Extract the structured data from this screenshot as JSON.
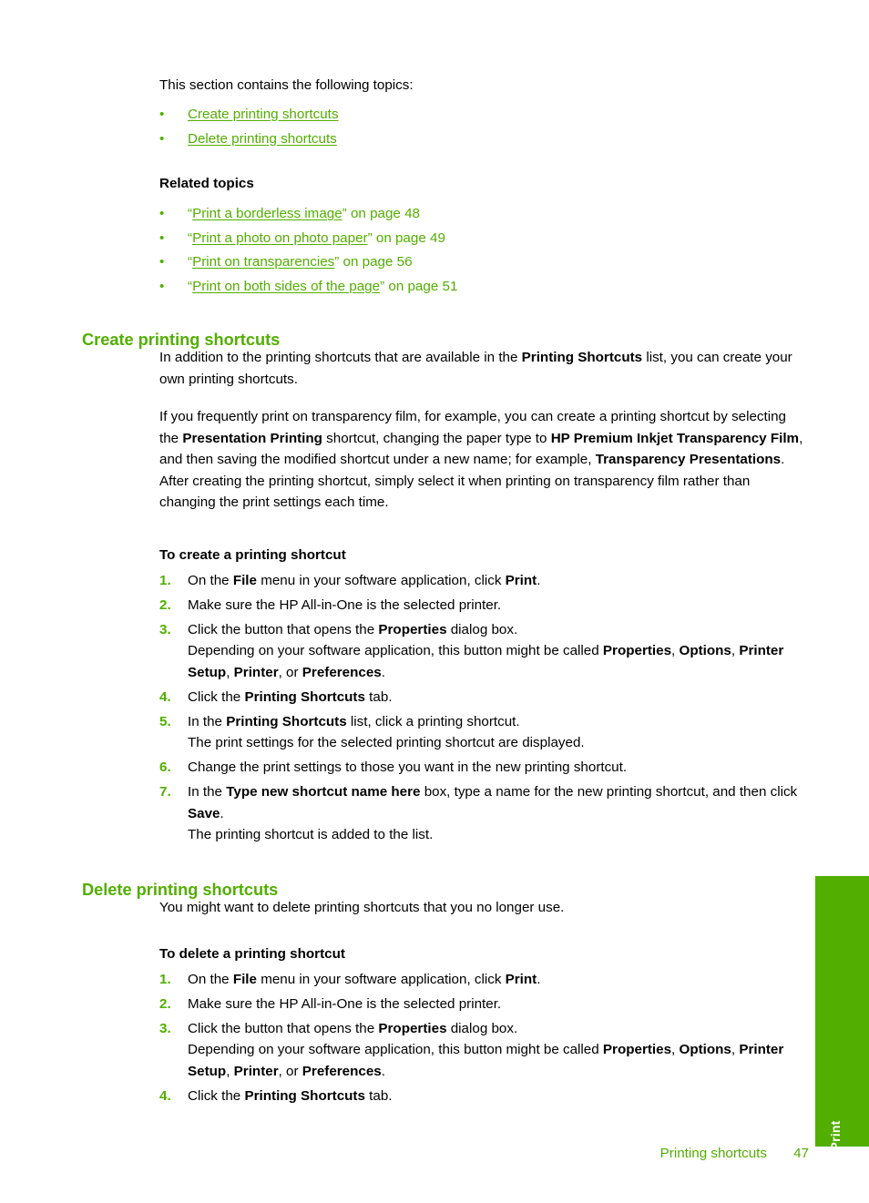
{
  "intro": {
    "lead": "This section contains the following topics:",
    "topics": [
      {
        "label": "Create printing shortcuts"
      },
      {
        "label": "Delete printing shortcuts"
      }
    ]
  },
  "related": {
    "heading": "Related topics",
    "items": [
      {
        "open_quote": "“",
        "link": "Print a borderless image",
        "close_quote": "”",
        "suffix": " on page 48"
      },
      {
        "open_quote": "“",
        "link": "Print a photo on photo paper",
        "close_quote": "”",
        "suffix": " on page 49"
      },
      {
        "open_quote": "“",
        "link": "Print on transparencies",
        "close_quote": "”",
        "suffix": " on page 56"
      },
      {
        "open_quote": "“",
        "link": "Print on both sides of the page",
        "close_quote": "”",
        "suffix": " on page 51"
      }
    ]
  },
  "create_section": {
    "heading": "Create printing shortcuts",
    "para1": {
      "t1": "In addition to the printing shortcuts that are available in the ",
      "b1": "Printing Shortcuts",
      "t2": " list, you can create your own printing shortcuts."
    },
    "para2": {
      "t1": "If you frequently print on transparency film, for example, you can create a printing shortcut by selecting the ",
      "b1": "Presentation Printing",
      "t2": " shortcut, changing the paper type to ",
      "b2": "HP Premium Inkjet Transparency Film",
      "t3": ", and then saving the modified shortcut under a new name; for example, ",
      "b3": "Transparency Presentations",
      "t4": ". After creating the printing shortcut, simply select it when printing on transparency film rather than changing the print settings each time."
    },
    "procedure_heading": "To create a printing shortcut",
    "steps": [
      {
        "num": "1.",
        "t1": "On the ",
        "b1": "File",
        "t2": " menu in your software application, click ",
        "b2": "Print",
        "t3": "."
      },
      {
        "num": "2.",
        "t1": "Make sure the HP All-in-One is the selected printer."
      },
      {
        "num": "3.",
        "t1": "Click the button that opens the ",
        "b1": "Properties",
        "t2": " dialog box.",
        "sub": {
          "t1": "Depending on your software application, this button might be called ",
          "b1": "Properties",
          "t2": ", ",
          "b2": "Options",
          "t3": ", ",
          "b3": "Printer Setup",
          "t4": ", ",
          "b4": "Printer",
          "t5": ", or ",
          "b5": "Preferences",
          "t6": "."
        }
      },
      {
        "num": "4.",
        "t1": "Click the ",
        "b1": "Printing Shortcuts",
        "t2": " tab."
      },
      {
        "num": "5.",
        "t1": "In the ",
        "b1": "Printing Shortcuts",
        "t2": " list, click a printing shortcut.",
        "sub": {
          "t1": "The print settings for the selected printing shortcut are displayed."
        }
      },
      {
        "num": "6.",
        "t1": "Change the print settings to those you want in the new printing shortcut."
      },
      {
        "num": "7.",
        "t1": "In the ",
        "b1": "Type new shortcut name here",
        "t2": " box, type a name for the new printing shortcut, and then click ",
        "b2": "Save",
        "t3": ".",
        "sub": {
          "t1": "The printing shortcut is added to the list."
        }
      }
    ]
  },
  "delete_section": {
    "heading": "Delete printing shortcuts",
    "para1": {
      "t1": "You might want to delete printing shortcuts that you no longer use."
    },
    "procedure_heading": "To delete a printing shortcut",
    "steps": [
      {
        "num": "1.",
        "t1": "On the ",
        "b1": "File",
        "t2": " menu in your software application, click ",
        "b2": "Print",
        "t3": "."
      },
      {
        "num": "2.",
        "t1": "Make sure the HP All-in-One is the selected printer."
      },
      {
        "num": "3.",
        "t1": "Click the button that opens the ",
        "b1": "Properties",
        "t2": " dialog box.",
        "sub": {
          "t1": "Depending on your software application, this button might be called ",
          "b1": "Properties",
          "t2": ", ",
          "b2": "Options",
          "t3": ", ",
          "b3": "Printer Setup",
          "t4": ", ",
          "b4": "Printer",
          "t5": ", or ",
          "b5": "Preferences",
          "t6": "."
        }
      },
      {
        "num": "4.",
        "t1": "Click the ",
        "b1": "Printing Shortcuts",
        "t2": " tab."
      }
    ]
  },
  "side_tab": {
    "label": "Print"
  },
  "footer": {
    "title": "Printing shortcuts",
    "page": "47"
  },
  "colors": {
    "accent_green": "#52AE00",
    "text_black": "#000000",
    "page_background": "#FFFFFF"
  }
}
